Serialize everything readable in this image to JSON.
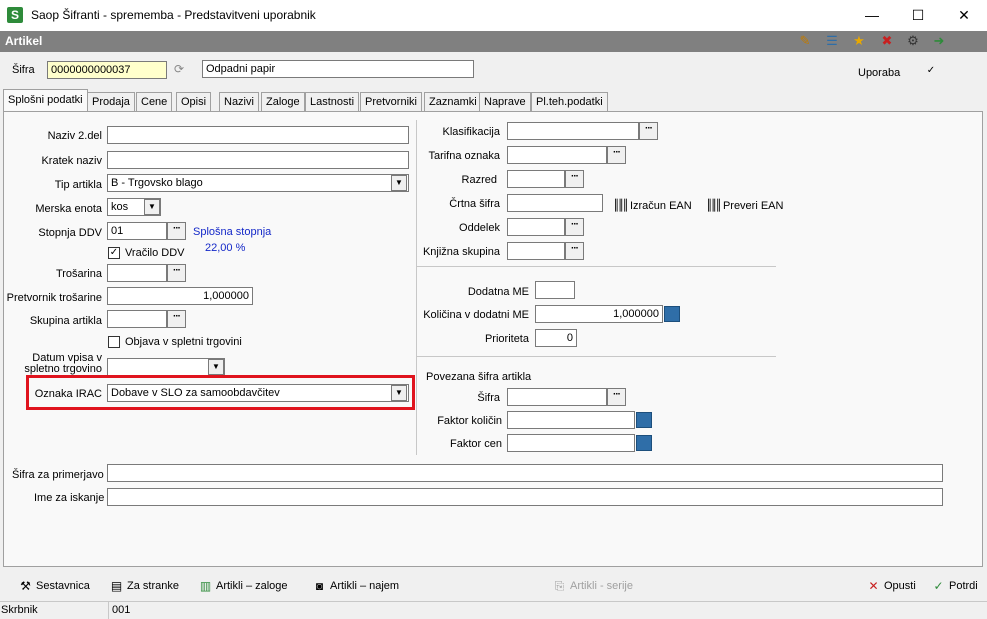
{
  "window": {
    "title": "Saop Šifranti - sprememba - Predstavitveni uporabnik",
    "icon_letter": "S",
    "minimize": "—",
    "maximize": "☐",
    "close": "✕"
  },
  "header": {
    "title": "Artikel"
  },
  "toolbar_icons": [
    "edit-icon",
    "list-icon",
    "star-icon",
    "delete-icon",
    "settings-icon",
    "export-icon"
  ],
  "top": {
    "sifra_label": "Šifra",
    "sifra_value": "0000000000037",
    "name_value": "Odpadni papir",
    "uporaba_label": "Uporaba",
    "uporaba_checked": "✓"
  },
  "tabs": [
    "Splošni podatki",
    "Prodaja",
    "Cene",
    "Opisi",
    "Nazivi",
    "Zaloge",
    "Lastnosti",
    "Pretvorniki",
    "Zaznamki",
    "Naprave",
    "Pl.teh.podatki"
  ],
  "left": {
    "naziv2_label": "Naziv 2.del",
    "naziv2_value": "",
    "kratek_label": "Kratek naziv",
    "kratek_value": "",
    "tip_label": "Tip artikla",
    "tip_value": "B - Trgovsko blago",
    "merska_label": "Merska enota",
    "merska_value": "kos",
    "ddv_label": "Stopnja DDV",
    "ddv_value": "01",
    "ddv_desc": "Splošna stopnja",
    "ddv_rate": "22,00 %",
    "vracilo_label": "Vračilo DDV",
    "vracilo_checked": "✓",
    "trosarina_label": "Trošarina",
    "trosarina_value": "",
    "pretvornik_label": "Pretvornik trošarine",
    "pretvornik_value": "1,000000",
    "skupina_label": "Skupina artikla",
    "skupina_value": "",
    "objava_label": "Objava v spletni trgovini",
    "objava_checked": "",
    "datum_label": "Datum vpisa  v spletno trgovino",
    "datum_value": "",
    "irac_label": "Oznaka IRAC",
    "irac_value": "Dobave v SLO za samoobdavčitev"
  },
  "right": {
    "klasifikacija_label": "Klasifikacija",
    "tarifna_label": "Tarifna oznaka",
    "razred_label": "Razred",
    "crtna_label": "Črtna šifra",
    "izracun_label": "Izračun EAN",
    "preveri_label": "Preveri EAN",
    "oddelek_label": "Oddelek",
    "knjizna_label": "Knjižna skupina",
    "dodatna_label": "Dodatna ME",
    "kolicina_label": "Količina v dodatni ME",
    "kolicina_value": "1,000000",
    "prioriteta_label": "Prioriteta",
    "prioriteta_value": "0",
    "povezana_label": "Povezana šifra artikla",
    "p_sifra_label": "Šifra",
    "faktor_kol_label": "Faktor količin",
    "faktor_cen_label": "Faktor cen"
  },
  "bottom": {
    "primerjavo_label": "Šifra za primerjavo",
    "iskanje_label": "Ime za iskanje"
  },
  "buttons": {
    "sestavnica": "Sestavnica",
    "za_stranke": "Za stranke",
    "artikli_zaloge": "Artikli – zaloge",
    "artikli_najem": "Artikli – najem",
    "artikli_serije": "Artikli - serije",
    "opusti": "Opusti",
    "potrdi": "Potrdi"
  },
  "status": {
    "label": "Skrbnik",
    "value": "001"
  }
}
